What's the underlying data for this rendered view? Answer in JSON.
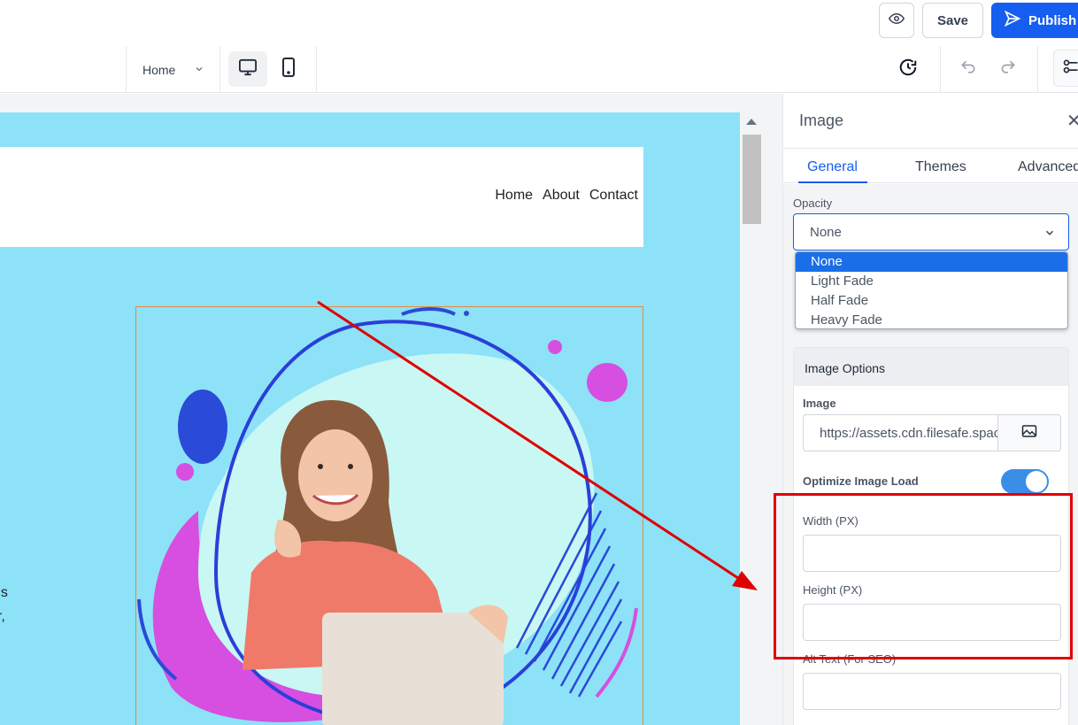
{
  "topbar": {
    "preview_icon": "eye-icon",
    "save_label": "Save",
    "publish_label": "Publish",
    "publish_icon": "send-icon"
  },
  "toolbar": {
    "page_select_value": "Home",
    "devices": [
      "desktop-icon",
      "mobile-icon"
    ],
    "active_device": "desktop",
    "history_icon": "history-icon",
    "undo_icon": "undo-icon",
    "redo_icon": "redo-icon",
    "settings_icon": "settings-icon"
  },
  "site": {
    "nav": [
      "Home",
      "About",
      "Contact"
    ],
    "hero_text_fragments": [
      "us",
      "er,"
    ],
    "background_color": "#8de2f7"
  },
  "panel": {
    "title": "Image",
    "tabs": [
      {
        "label": "General",
        "active": true
      },
      {
        "label": "Themes",
        "active": false
      },
      {
        "label": "Advanced",
        "active": false
      }
    ],
    "opacity": {
      "label": "Opacity",
      "value": "None",
      "options": [
        "None",
        "Light Fade",
        "Half Fade",
        "Heavy Fade"
      ],
      "selected": "None"
    },
    "image_options": {
      "heading": "Image Options",
      "image_label": "Image",
      "image_url": "https://assets.cdn.filesafe.space/",
      "optimize_label": "Optimize Image Load",
      "optimize_on": true,
      "width_label": "Width (PX)",
      "width_value": "",
      "height_label": "Height (PX)",
      "height_value": "",
      "alt_label": "Alt Text (For SEO)",
      "alt_value": ""
    }
  },
  "colors": {
    "accent": "#155eef",
    "annotation": "#e00000"
  }
}
